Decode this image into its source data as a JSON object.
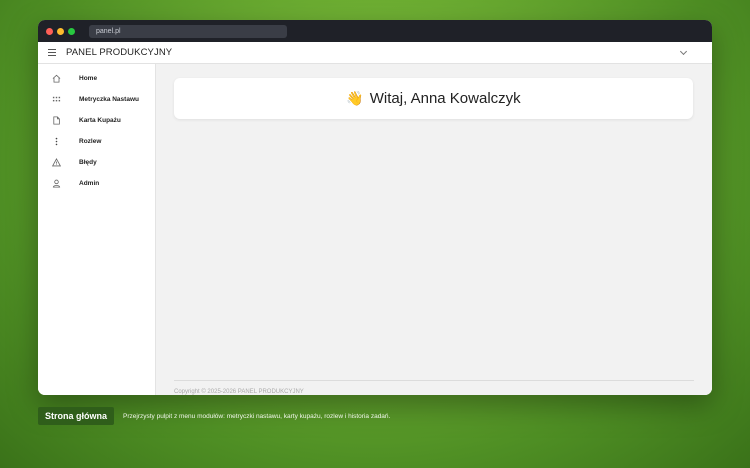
{
  "browser": {
    "url": "panel.pl"
  },
  "app": {
    "title": "PANEL PRODUKCYJNY"
  },
  "sidebar": {
    "items": [
      {
        "label": "Home",
        "icon": "home-icon"
      },
      {
        "label": "Metryczka Nastawu",
        "icon": "grid-icon"
      },
      {
        "label": "Karta Kupażu",
        "icon": "document-icon"
      },
      {
        "label": "Rozlew",
        "icon": "dots-vertical-icon"
      },
      {
        "label": "Błędy",
        "icon": "warning-icon"
      },
      {
        "label": "Admin",
        "icon": "user-icon"
      }
    ]
  },
  "main": {
    "welcome_emoji": "👋",
    "welcome_text": "Witaj, Anna Kowalczyk",
    "footer": "Copyright © 2025-2026 PANEL PRODUKCYJNY"
  },
  "caption": {
    "badge": "Strona główna",
    "text": "Przejrzysty pulpit z menu modułów: metryczki nastawu, karty kupażu, rozlew i historia zadań."
  },
  "colors": {
    "background": "#6fb033",
    "titlebar": "#1f2128",
    "badge": "#2f5e1a",
    "main_bg": "#f2f2f2"
  }
}
